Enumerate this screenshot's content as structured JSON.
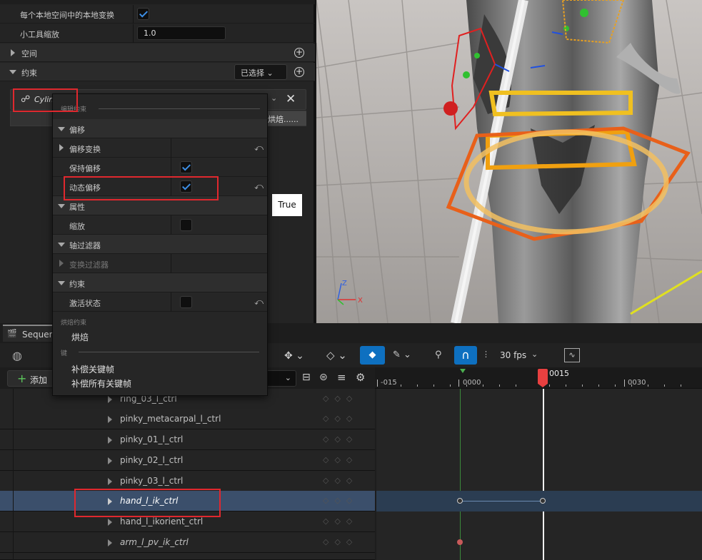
{
  "details": {
    "rows": [
      {
        "label": "每个本地空间中的本地变换",
        "checked": true
      },
      {
        "label": "小工具缩放",
        "value": "1.0"
      }
    ],
    "space_label": "空间",
    "constraint_label": "约束",
    "constraint_dropdown": "已选择",
    "constraint_item": "Cylin",
    "bake_button": "烘焙......",
    "tooltip": "True"
  },
  "menu": {
    "edit_header": "编辑约束",
    "offset_section": "偏移",
    "offset_transform": "偏移变换",
    "keep_offset": "保持偏移",
    "dynamic_offset": "动态偏移",
    "properties_section": "属性",
    "scale": "缩放",
    "axis_filter_section": "轴过滤器",
    "transform_filter": "变换过滤器",
    "constraint_section": "约束",
    "active_state": "激活状态",
    "bake_header": "烘焙约束",
    "bake_item": "烘焙",
    "key_header": "键",
    "compensate_key": "补偿关键帧",
    "compensate_all": "补偿所有关键帧"
  },
  "viewport": {
    "axis_z": "Z",
    "axis_x": "X"
  },
  "sequencer": {
    "tab_title": "Sequen",
    "add_button": "添加",
    "fps": "30 fps",
    "timeline": {
      "current_frame": "0015",
      "ticks": [
        "-015",
        "0000",
        "0030"
      ]
    },
    "tracks": [
      {
        "name": "ring_03_l_ctrl"
      },
      {
        "name": "pinky_metacarpal_l_ctrl"
      },
      {
        "name": "pinky_01_l_ctrl"
      },
      {
        "name": "pinky_02_l_ctrl"
      },
      {
        "name": "pinky_03_l_ctrl"
      },
      {
        "name": "hand_l_ik_ctrl",
        "selected": true
      },
      {
        "name": "hand_l_ikorient_ctrl"
      },
      {
        "name": "arm_l_pv_ik_ctrl"
      }
    ]
  },
  "colors": {
    "accent_blue": "#0e70c0",
    "playhead_red": "#e84040",
    "highlight_red": "#e0282e",
    "selected_row": "#3b4f6b"
  }
}
